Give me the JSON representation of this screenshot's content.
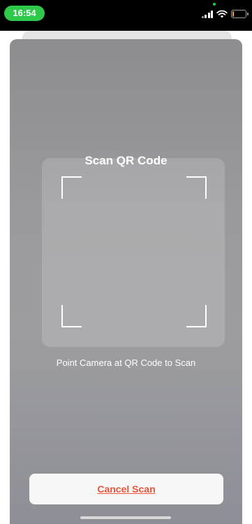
{
  "status_bar": {
    "time": "16:54",
    "icons": [
      "signal-icon",
      "wifi-icon",
      "battery-icon"
    ],
    "battery_level": 0.1,
    "colors": {
      "time_pill": "#2ec94a",
      "battery": "#f39b2b"
    }
  },
  "scanner": {
    "title": "Scan QR Code",
    "instruction": "Point Camera at QR Code to Scan",
    "cancel_label": "Cancel Scan",
    "colors": {
      "cancel_text": "#e8553a",
      "frame_corners": "#ffffff"
    }
  }
}
